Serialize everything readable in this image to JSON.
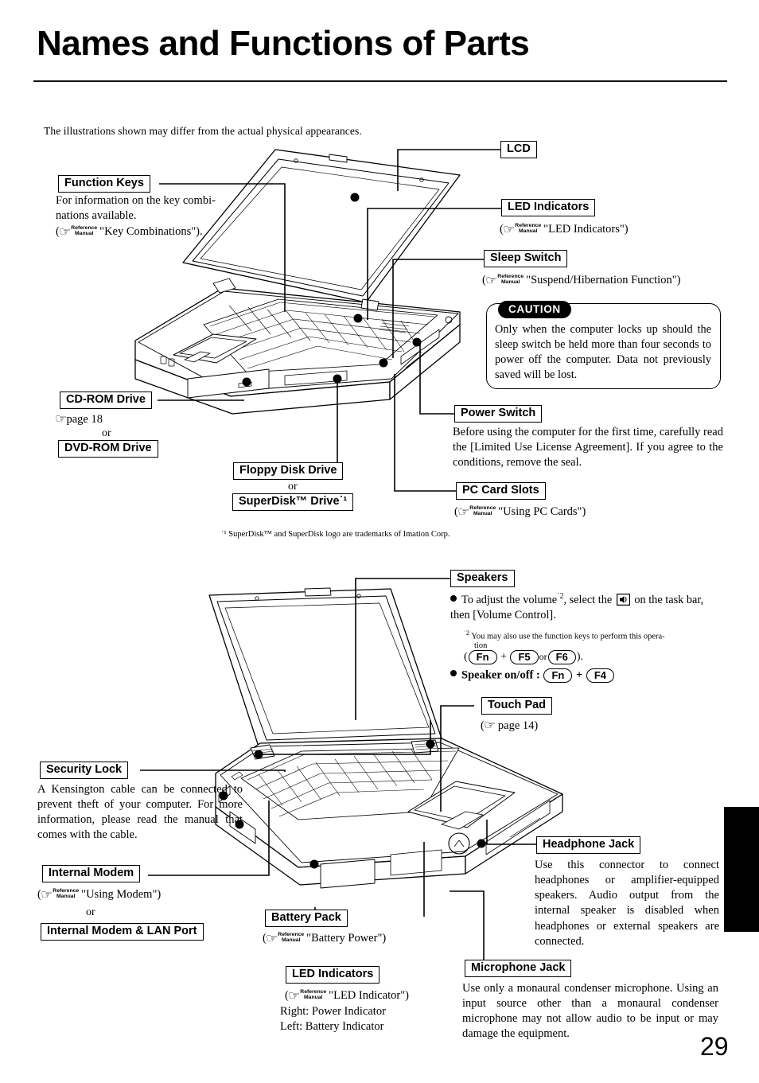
{
  "page": {
    "title": "Names and Functions of Parts",
    "intro": "The illustrations shown may differ from the actual physical appearances.",
    "page_number": "29",
    "reference_manual_line1": "Reference",
    "reference_manual_line2": "Manual",
    "hand_icon": "☞",
    "or_label": "or"
  },
  "figure1": {
    "callouts": {
      "function_keys": {
        "label": "Function Keys",
        "body": "For information on the key combi-nations available.",
        "ref": "\"Key Combinations\")."
      },
      "lcd": {
        "label": "LCD"
      },
      "led_indicators": {
        "label": "LED Indicators",
        "ref": "\"LED Indicators\")"
      },
      "sleep_switch": {
        "label": "Sleep Switch",
        "ref": "\"Suspend/Hibernation Function\")"
      },
      "caution": {
        "badge": "CAUTION",
        "text": "Only when the computer locks up should the sleep switch be held  more than four seconds to power off the computer.  Data not previously saved will be lost."
      },
      "power_switch": {
        "label": "Power Switch",
        "body": "Before using the computer for the first time, carefully read the [Limited Use License Agreement]. If you agree to the conditions, remove the seal."
      },
      "pc_card_slots": {
        "label": "PC Card Slots",
        "ref": "\"Using PC Cards\")"
      },
      "cd_rom_drive": {
        "label": "CD-ROM Drive",
        "page_ref": "page 18"
      },
      "dvd_rom_drive": {
        "label": "DVD-ROM Drive"
      },
      "floppy_disk_drive": {
        "label": "Floppy Disk Drive"
      },
      "superdisk_drive": {
        "label": "SuperDisk™ Drive˙¹"
      }
    },
    "footnote": "˙¹ SuperDisk™ and SuperDisk logo are trademarks of Imation Corp."
  },
  "figure2": {
    "callouts": {
      "speakers": {
        "label": "Speakers",
        "bullet1_part1": "To adjust the volume",
        "bullet1_sup": "˙2",
        "bullet1_part2": ", select the",
        "bullet1_part3": "on the task bar, then [Volume Control].",
        "footnote_sup": "˙2",
        "footnote_text": "You may also use the function keys to perform this opera-",
        "footnote_text2": "tion",
        "combo_open": "(",
        "combo_fn": "Fn",
        "combo_plus": "+",
        "combo_f5": "F5",
        "combo_or": "or",
        "combo_f6": "F6",
        "combo_close": ").",
        "bullet2_label": "Speaker on/off :",
        "bullet2_fn": "Fn",
        "bullet2_plus": "+",
        "bullet2_f4": "F4"
      },
      "touch_pad": {
        "label": "Touch Pad",
        "page_ref": "page 14"
      },
      "security_lock": {
        "label": "Security Lock",
        "body": "A Kensington cable can be connected to prevent theft of your computer. For more information, please read the manual that comes with the cable."
      },
      "internal_modem": {
        "label": "Internal Modem",
        "ref": "\"Using Modem\")"
      },
      "internal_modem_lan": {
        "label": "Internal Modem & LAN Port"
      },
      "battery_pack": {
        "label": "Battery Pack",
        "ref": "\"Battery Power\")"
      },
      "led_indicators": {
        "label": "LED Indicators",
        "ref": "\"LED Indicator\")",
        "right_line": "Right: Power Indicator",
        "left_line": "Left: Battery Indicator"
      },
      "headphone_jack": {
        "label": "Headphone Jack",
        "body": "Use this connector to connect headphones or amplifier-equipped speakers.  Audio output from the internal speaker is disabled when headphones or external speakers are connected."
      },
      "microphone_jack": {
        "label": "Microphone Jack",
        "body": "Use only a monaural condenser microphone. Using an input source other than a monaural condenser microphone may not allow audio to be input or may damage the equipment."
      }
    }
  }
}
